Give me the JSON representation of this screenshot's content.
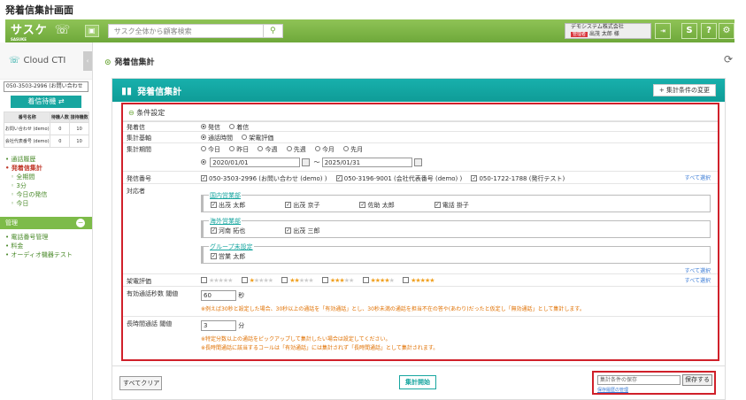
{
  "page_title": "発着信集計画面",
  "topbar": {
    "logo": "サスケ",
    "logo_sub": "SASUKE",
    "search_placeholder": "サスク全体から顧客検索",
    "company": "デモシステム株式会社",
    "role_badge": "管理者",
    "user": "出茂 太郎 様",
    "logout": "Logout"
  },
  "sidebar": {
    "title": "Cloud CTI",
    "line_select": "050-3503-2996 (お問い合わせ",
    "standby_button": "着信待機",
    "table_headers": [
      "番号名称",
      "待機人数",
      "接待機数"
    ],
    "table_rows": [
      [
        "お問い合わせ (demo)",
        "0",
        "10"
      ],
      [
        "会社代表番号 (demo)",
        "0",
        "10"
      ]
    ],
    "nav": {
      "history": "通話履歴",
      "summary": "発着信集計",
      "all_period": "全期間",
      "minutes": "3分",
      "today_out": "今日の発信",
      "today": "今日"
    },
    "admin_section": "管理",
    "admin_items": [
      "電話番号管理",
      "料金",
      "オーディオ機器テスト"
    ]
  },
  "breadcrumb": "発着信集計",
  "panel": {
    "title": "発着信集計",
    "change_button": "+ 集計条件の変更",
    "cond_title": "条件設定",
    "labels": {
      "direction": "発着信",
      "basis": "集計基軸",
      "period": "集計期間",
      "numbers": "発信番号",
      "targets": "対応者",
      "rating": "架電評価",
      "valid_sec": "有効通話秒数 閾値",
      "long_min": "長時間通話 閾値"
    },
    "direction_opts": [
      "発信",
      "着信"
    ],
    "basis_opts": [
      "通話時間",
      "架電評価"
    ],
    "period_opts": [
      "今日",
      "昨日",
      "今週",
      "先週",
      "今月",
      "先月"
    ],
    "date_from": "2020/01/01",
    "date_to": "2025/01/31",
    "date_sep": "～",
    "numbers": [
      "050-3503-2996 (お問い合わせ (demo) )",
      "050-3196-9001 (会社代表番号 (demo) )",
      "050-1722-1788 (発行テスト)"
    ],
    "select_all": "すべて選択",
    "groups": [
      {
        "name": "国内営業部",
        "members": [
          "出茂 太郎",
          "出茂 京子",
          "佐助 太郎",
          "電話 掛子"
        ]
      },
      {
        "name": "海外営業部",
        "members": [
          "河南 拓也",
          "出茂 三郎"
        ]
      },
      {
        "name": "グループ未設定",
        "members": [
          "営業 太郎"
        ]
      }
    ],
    "valid_sec_value": "60",
    "valid_sec_unit": "秒",
    "valid_note": "※例えば30秒と設定した場合、30秒以上の通話を「有効通話」とし、30秒未満の通話を担当不在の答や(あわり)だったと仮定し「無効通話」として集計します。",
    "long_min_value": "3",
    "long_min_unit": "分",
    "long_note1": "※特定分数以上の通話をピックアップして集計したい場合は設定してください。",
    "long_note2": "※長時間通話に該当するコールは「有効通話」には集計されず「長時間通話」として集計されます。"
  },
  "footer": {
    "clear_button": "すべてクリア",
    "start_button": "集計開始",
    "save_placeholder": "集計条件の保存",
    "save_button": "保存する",
    "history_link": "保存履歴の管理"
  },
  "colors": {
    "green": "#6ea83a",
    "teal": "#18a6a0",
    "highlight_red": "#d0202a",
    "star": "#f0a020"
  }
}
